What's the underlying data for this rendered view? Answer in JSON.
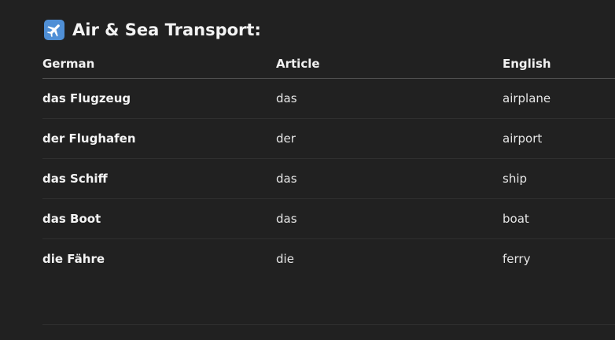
{
  "section": {
    "icon": "airplane-icon",
    "title": "Air & Sea Transport:"
  },
  "table": {
    "headers": [
      "German",
      "Article",
      "English"
    ],
    "rows": [
      {
        "german": "das Flugzeug",
        "article": "das",
        "english": "airplane"
      },
      {
        "german": "der Flughafen",
        "article": "der",
        "english": "airport"
      },
      {
        "german": "das Schiff",
        "article": "das",
        "english": "ship"
      },
      {
        "german": "das Boot",
        "article": "das",
        "english": "boat"
      },
      {
        "german": "die Fähre",
        "article": "die",
        "english": "ferry"
      }
    ]
  },
  "colors": {
    "background": "#212121",
    "text": "#ececec",
    "icon_blue": "#4f8fd6"
  }
}
